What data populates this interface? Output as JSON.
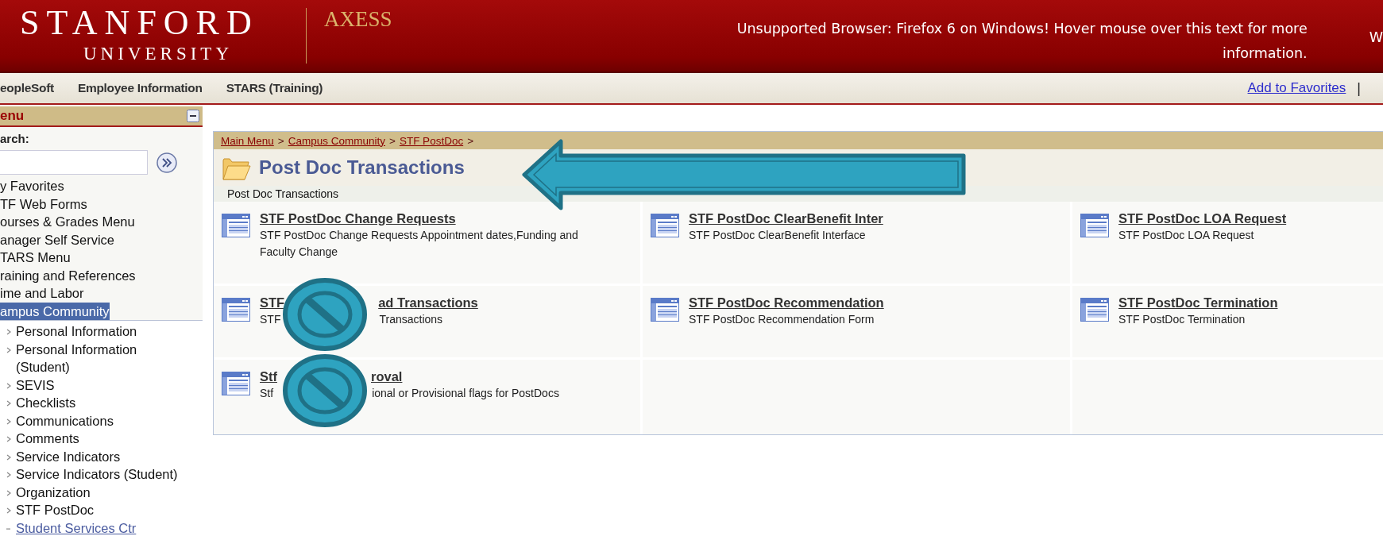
{
  "header": {
    "logo_top": "STANFORD",
    "logo_bottom": "UNIVERSITY",
    "app_name": "AXESS",
    "browser_warning": "Unsupported Browser: Firefox 6 on Windows! Hover mouse over this text for more information.",
    "edge_text": "W"
  },
  "nav": {
    "items": [
      "eopleSoft",
      "Employee Information",
      "STARS (Training)"
    ],
    "add_favorites": "Add to Favorites",
    "separator": "|"
  },
  "sidebar": {
    "title": "enu",
    "search_label": "arch:",
    "items": [
      {
        "label": "y Favorites",
        "selected": false
      },
      {
        "label": "TF Web Forms",
        "selected": false
      },
      {
        "label": "ourses & Grades Menu",
        "selected": false
      },
      {
        "label": "anager Self Service",
        "selected": false
      },
      {
        "label": "TARS Menu",
        "selected": false
      },
      {
        "label": "raining and References",
        "selected": false
      },
      {
        "label": "ime and Labor",
        "selected": false
      },
      {
        "label": "ampus Community",
        "selected": true
      }
    ],
    "children": [
      {
        "label": "Personal Information",
        "kind": "folder"
      },
      {
        "label": "Personal Information (Student)",
        "kind": "folder"
      },
      {
        "label": "SEVIS",
        "kind": "folder"
      },
      {
        "label": "Checklists",
        "kind": "folder"
      },
      {
        "label": "Communications",
        "kind": "folder"
      },
      {
        "label": "Comments",
        "kind": "folder"
      },
      {
        "label": "Service Indicators",
        "kind": "folder"
      },
      {
        "label": "Service Indicators (Student)",
        "kind": "folder"
      },
      {
        "label": "Organization",
        "kind": "folder"
      },
      {
        "label": "STF PostDoc",
        "kind": "folder"
      },
      {
        "label": "Student Services Ctr",
        "kind": "link"
      }
    ]
  },
  "main": {
    "breadcrumb": [
      "Main Menu",
      "Campus Community",
      "STF PostDoc"
    ],
    "breadcrumb_separator": ">",
    "title": "Post Doc Transactions",
    "subtitle": "Post Doc Transactions",
    "items": [
      {
        "title_parts": [
          "STF PostDoc Change Requests"
        ],
        "desc_parts": [
          "STF PostDoc Change Requests Appointment dates,Funding and Faculty Change"
        ]
      },
      {
        "title_parts": [
          "STF PostDoc ClearBenefit Inter"
        ],
        "desc_parts": [
          "STF PostDoc ClearBenefit Interface"
        ]
      },
      {
        "title_parts": [
          "STF PostDoc LOA Request"
        ],
        "desc_parts": [
          "STF PostDoc LOA Request"
        ]
      },
      {
        "title_parts": [
          "STF",
          "ad Transactions"
        ],
        "desc_parts": [
          "STF",
          "Transactions"
        ]
      },
      {
        "title_parts": [
          "STF PostDoc Recommendation"
        ],
        "desc_parts": [
          "STF PostDoc Recommendation Form"
        ]
      },
      {
        "title_parts": [
          "STF PostDoc Termination"
        ],
        "desc_parts": [
          "STF PostDoc Termination"
        ]
      },
      {
        "title_parts": [
          "Stf",
          "roval"
        ],
        "desc_parts": [
          "Stf",
          "ional or Provisional flags for PostDocs"
        ]
      }
    ]
  }
}
